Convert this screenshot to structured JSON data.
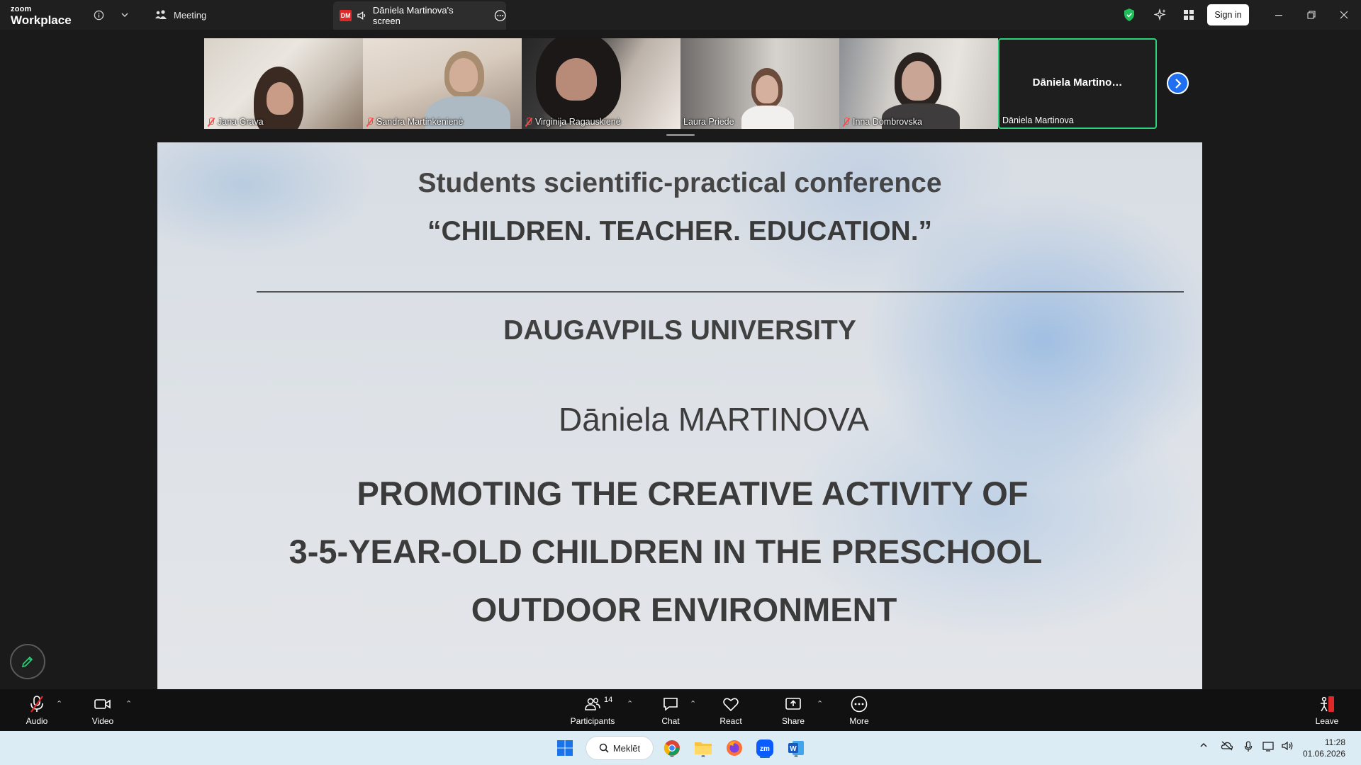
{
  "window": {
    "brand_line1": "zoom",
    "brand_line2": "Workplace",
    "meeting_label": "Meeting",
    "share_tab": {
      "badge": "DM",
      "label": "Dāniela Martinova's screen"
    },
    "sign_in": "Sign in"
  },
  "participants_strip": [
    {
      "name": "Jana Grava",
      "muted": true
    },
    {
      "name": "Sandra Martinkėnienė",
      "muted": true
    },
    {
      "name": "Virginija Ragauskienė",
      "muted": true
    },
    {
      "name": "Laura Priede",
      "muted": false
    },
    {
      "name": "Inna Dombrovska",
      "muted": true
    },
    {
      "name": "Dāniela Martinova",
      "center_label": "Dāniela  Martino…",
      "active_speaker": true
    }
  ],
  "slide": {
    "conference": "Students scientific-practical conference",
    "conference_quote": "“CHILDREN. TEACHER. EDUCATION.”",
    "university": "DAUGAVPILS UNIVERSITY",
    "author": "Dāniela MARTINOVA",
    "title_line1": "PROMOTING THE CREATIVE ACTIVITY OF",
    "title_line2": "3-5-YEAR-OLD CHILDREN IN THE PRESCHOOL",
    "title_line3": "OUTDOOR ENVIRONMENT"
  },
  "toolbar": {
    "audio": "Audio",
    "video": "Video",
    "participants": "Participants",
    "participants_count": "14",
    "chat": "Chat",
    "react": "React",
    "share": "Share",
    "more": "More",
    "leave": "Leave"
  },
  "taskbar": {
    "search": "Meklēt",
    "time": "11:28",
    "date": "01.06.2026"
  },
  "colors": {
    "active_speaker_border": "#2bd47a",
    "leave_red": "#e02828",
    "next_button": "#1f6ff0"
  }
}
